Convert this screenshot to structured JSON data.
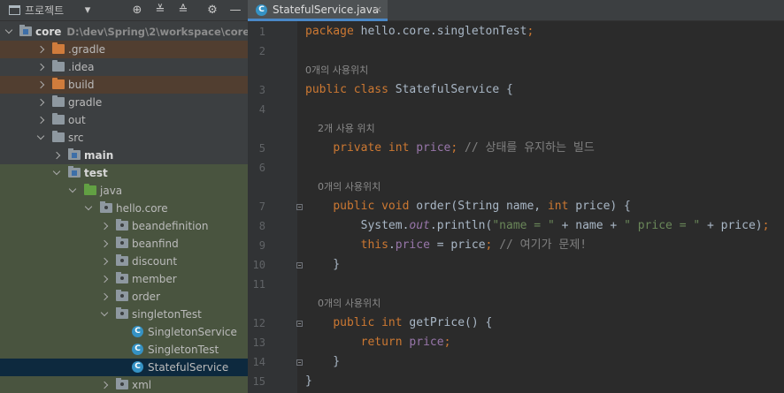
{
  "project_panel": {
    "title": "프로젝트",
    "toolbar_icons": [
      "target-icon",
      "expand-all-icon",
      "collapse-all-icon",
      "gear-icon",
      "minimize-icon"
    ],
    "tree": [
      {
        "label": "core",
        "path": "D:\\dev\\Spring\\2\\workspace\\core",
        "depth": 0,
        "icon": "folder-module",
        "expanded": true
      },
      {
        "label": ".gradle",
        "depth": 1,
        "icon": "folder-orange",
        "expanded": false,
        "state": "excluded"
      },
      {
        "label": ".idea",
        "depth": 1,
        "icon": "folder",
        "expanded": false
      },
      {
        "label": "build",
        "depth": 1,
        "icon": "folder-orange",
        "expanded": false,
        "state": "excluded"
      },
      {
        "label": "gradle",
        "depth": 1,
        "icon": "folder",
        "expanded": false
      },
      {
        "label": "out",
        "depth": 1,
        "icon": "folder",
        "expanded": false
      },
      {
        "label": "src",
        "depth": 1,
        "icon": "folder",
        "expanded": true
      },
      {
        "label": "main",
        "depth": 2,
        "icon": "folder-module",
        "expanded": false,
        "bold": true
      },
      {
        "label": "test",
        "depth": 2,
        "icon": "folder-module",
        "expanded": true,
        "bold": true,
        "state": "test"
      },
      {
        "label": "java",
        "depth": 3,
        "icon": "folder-green",
        "expanded": true,
        "state": "test"
      },
      {
        "label": "hello.core",
        "depth": 4,
        "icon": "folder-package",
        "expanded": true,
        "state": "test"
      },
      {
        "label": "beandefinition",
        "depth": 5,
        "icon": "folder-package",
        "expanded": false,
        "state": "test"
      },
      {
        "label": "beanfind",
        "depth": 5,
        "icon": "folder-package",
        "expanded": false,
        "state": "test"
      },
      {
        "label": "discount",
        "depth": 5,
        "icon": "folder-package",
        "expanded": false,
        "state": "test"
      },
      {
        "label": "member",
        "depth": 5,
        "icon": "folder-package",
        "expanded": false,
        "state": "test"
      },
      {
        "label": "order",
        "depth": 5,
        "icon": "folder-package",
        "expanded": false,
        "state": "test"
      },
      {
        "label": "singletonTest",
        "depth": 5,
        "icon": "folder-package",
        "expanded": true,
        "state": "test"
      },
      {
        "label": "SingletonService",
        "depth": 6,
        "icon": "class",
        "state": "test"
      },
      {
        "label": "SingletonTest",
        "depth": 6,
        "icon": "class",
        "state": "test"
      },
      {
        "label": "StatefulService",
        "depth": 6,
        "icon": "class",
        "state": "selected"
      },
      {
        "label": "xml",
        "depth": 5,
        "icon": "folder-package",
        "expanded": false,
        "state": "test"
      }
    ]
  },
  "editor": {
    "tab": {
      "label": "StatefulService.java",
      "icon": "class-icon",
      "close": "×"
    },
    "lines": [
      {
        "n": "1",
        "tokens": [
          [
            "kw",
            "package "
          ],
          [
            "p",
            "hello.core.singletonTest"
          ],
          [
            "kw",
            ";"
          ]
        ]
      },
      {
        "n": "2",
        "tokens": []
      },
      {
        "hint": "0개의 사용위치"
      },
      {
        "n": "3",
        "tokens": [
          [
            "kw",
            "public class "
          ],
          [
            "p",
            "StatefulService {"
          ]
        ]
      },
      {
        "n": "4",
        "tokens": []
      },
      {
        "hint": "    2개 사용 위치"
      },
      {
        "n": "5",
        "tokens": [
          [
            "p",
            "    "
          ],
          [
            "kw",
            "private int "
          ],
          [
            "fld",
            "price"
          ],
          [
            "kw",
            "; "
          ],
          [
            "cm",
            "// 상태를 유지하는 빌드"
          ]
        ]
      },
      {
        "n": "6",
        "tokens": []
      },
      {
        "hint": "    0개의 사용위치"
      },
      {
        "n": "7",
        "fold": true,
        "tokens": [
          [
            "p",
            "    "
          ],
          [
            "kw",
            "public void "
          ],
          [
            "p",
            "order(String name, "
          ],
          [
            "kw",
            "int "
          ],
          [
            "p",
            "price) {"
          ]
        ]
      },
      {
        "n": "8",
        "tokens": [
          [
            "p",
            "        System."
          ],
          [
            "it",
            "out"
          ],
          [
            "p",
            ".println("
          ],
          [
            "str",
            "\"name = \""
          ],
          [
            "p",
            " + name + "
          ],
          [
            "str",
            "\" price = \""
          ],
          [
            "p",
            " + price)"
          ],
          [
            "kw",
            ";"
          ]
        ]
      },
      {
        "n": "9",
        "tokens": [
          [
            "p",
            "        "
          ],
          [
            "kw",
            "this"
          ],
          [
            "p",
            "."
          ],
          [
            "fld",
            "price"
          ],
          [
            "p",
            " = price"
          ],
          [
            "kw",
            "; "
          ],
          [
            "cm",
            "// 여기가 문제!"
          ]
        ]
      },
      {
        "n": "10",
        "fold": true,
        "tokens": [
          [
            "p",
            "    }"
          ]
        ]
      },
      {
        "n": "11",
        "tokens": []
      },
      {
        "hint": "    0개의 사용위치"
      },
      {
        "n": "12",
        "fold": true,
        "tokens": [
          [
            "p",
            "    "
          ],
          [
            "kw",
            "public int "
          ],
          [
            "p",
            "getPrice() {"
          ]
        ]
      },
      {
        "n": "13",
        "tokens": [
          [
            "p",
            "        "
          ],
          [
            "kw",
            "return "
          ],
          [
            "fld",
            "price"
          ],
          [
            "kw",
            ";"
          ]
        ]
      },
      {
        "n": "14",
        "fold": true,
        "tokens": [
          [
            "p",
            "    }"
          ]
        ]
      },
      {
        "n": "15",
        "tokens": [
          [
            "p",
            "}"
          ]
        ]
      }
    ]
  },
  "colors": {
    "keyword": "#cc7832",
    "field": "#9876aa",
    "string": "#6a8759",
    "comment": "#808080",
    "plain": "#a9b7c6",
    "selection": "#0d293e",
    "test_bg": "#49543f",
    "excluded_bg": "#513e30"
  }
}
